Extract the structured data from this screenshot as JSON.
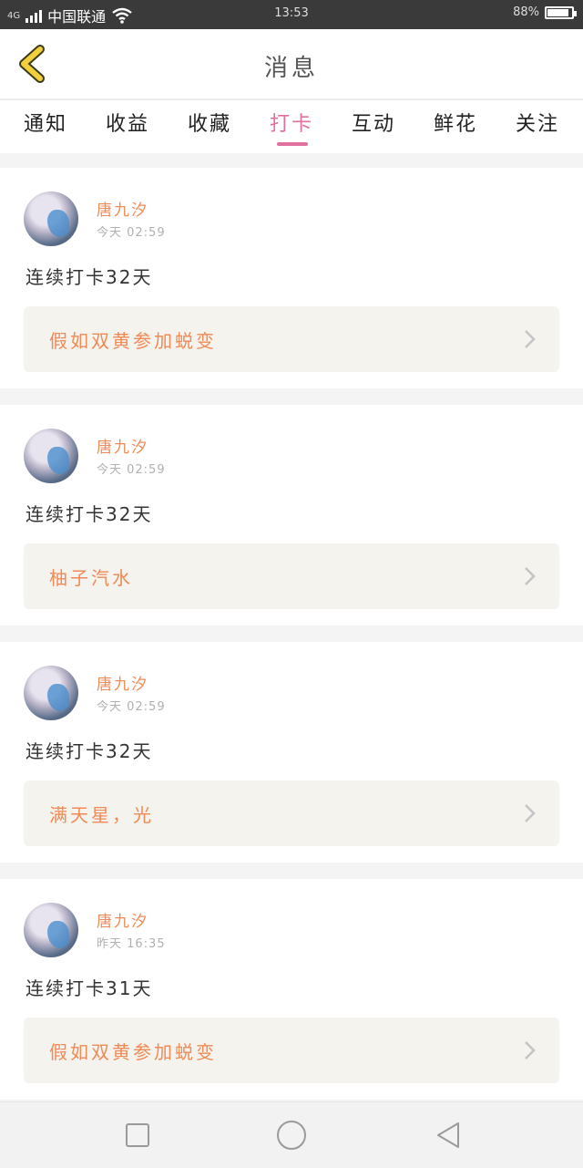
{
  "status_bar": {
    "network": "4G",
    "carrier": "中国联通",
    "time": "13:53",
    "battery": "88%",
    "battery_level": 0.88
  },
  "header": {
    "back_icon": "chevron-left-icon",
    "title": "消息",
    "accent_color": "#f2d03b"
  },
  "tabs": [
    {
      "label": "通知"
    },
    {
      "label": "收益"
    },
    {
      "label": "收藏"
    },
    {
      "label": "打卡",
      "active": true
    },
    {
      "label": "互动"
    },
    {
      "label": "鲜花"
    },
    {
      "label": "关注"
    }
  ],
  "colors": {
    "active_tab": "#e0709e",
    "link_text": "#f08a56",
    "link_bg": "#f4f3ee"
  },
  "feed": [
    {
      "user": "唐九汐",
      "time": "今天 02:59",
      "content": "连续打卡32天",
      "link": "假如双黄参加蜕变"
    },
    {
      "user": "唐九汐",
      "time": "今天 02:59",
      "content": "连续打卡32天",
      "link": "柚子汽水"
    },
    {
      "user": "唐九汐",
      "time": "今天 02:59",
      "content": "连续打卡32天",
      "link": "满天星，光"
    },
    {
      "user": "唐九汐",
      "time": "昨天 16:35",
      "content": "连续打卡31天",
      "link": "假如双黄参加蜕变"
    }
  ],
  "nav": {
    "recent_icon": "square-icon",
    "home_icon": "circle-icon",
    "back_icon": "triangle-back-icon"
  }
}
